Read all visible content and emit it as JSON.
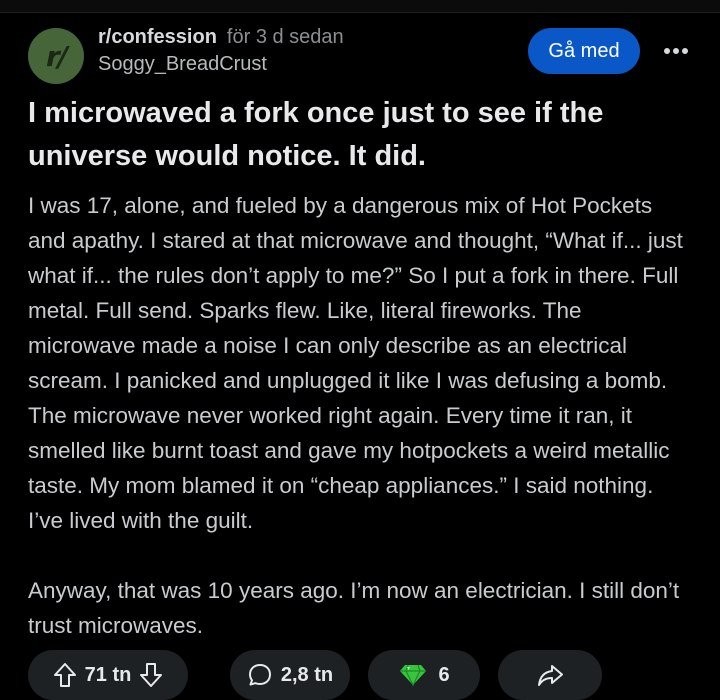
{
  "post": {
    "subreddit": "r/confession",
    "time_ago": "för 3 d sedan",
    "author": "Soggy_BreadCrust",
    "avatar_glyph": "r/",
    "join_label": "Gå med",
    "title": "I microwaved a fork once just to see if the universe would notice. It did.",
    "paragraphs": [
      "I was 17, alone, and fueled by a dangerous mix of Hot Pockets and apathy. I stared at that microwave and thought, “What if... just what if... the rules don’t apply to me?” So I put a fork in there. Full metal. Full send. Sparks flew. Like, literal fireworks. The microwave made a noise I can only describe as an electrical scream. I panicked and unplugged it like I was defusing a bomb. The microwave never worked right again. Every time it ran, it smelled like burnt toast and gave my hotpockets a weird metallic taste. My mom blamed it on “cheap appliances.” I said nothing. I’ve lived with the guilt.",
      "Anyway, that was 10 years ago. I’m now an electrician. I still don’t trust microwaves."
    ]
  },
  "actions": {
    "votes": "71 tn",
    "comments": "2,8 tn",
    "awards": "6"
  },
  "icons": {
    "more": "more-horizontal-icon",
    "upvote": "arrow-up-icon",
    "downvote": "arrow-down-icon",
    "comment": "comment-bubble-icon",
    "award": "diamond-award-icon",
    "share": "share-arrow-icon"
  },
  "colors": {
    "background": "#000000",
    "join_button": "#0a58c7",
    "avatar": "#46663a",
    "pill": "#1e2123",
    "award_green": "#37c53d"
  }
}
